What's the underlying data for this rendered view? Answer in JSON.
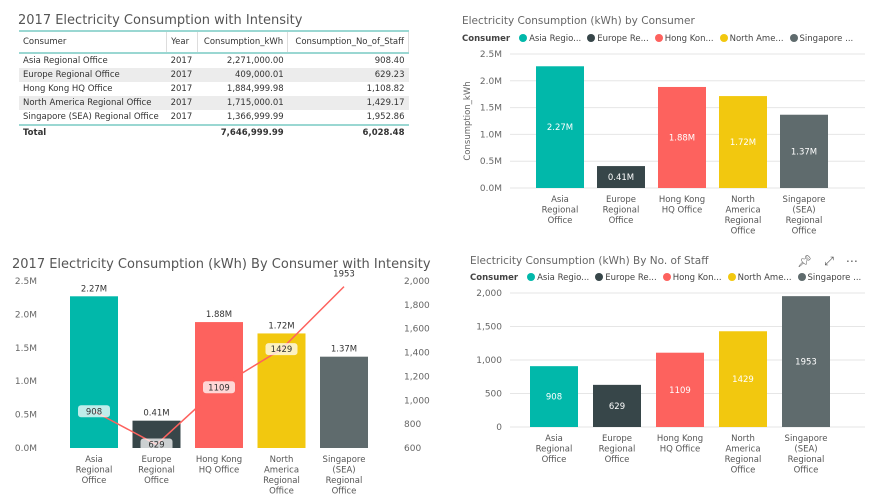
{
  "table_visual": {
    "title": "2017 Electricity Consumption with Intensity",
    "columns": [
      "Consumer",
      "Year",
      "Consumption_kWh",
      "Consumption_No_of_Staff"
    ],
    "rows": [
      [
        "Asia Regional Office",
        "2017",
        "2,271,000.00",
        "908.40"
      ],
      [
        "Europe Regional Office",
        "2017",
        "409,000.01",
        "629.23"
      ],
      [
        "Hong Kong HQ Office",
        "2017",
        "1,884,999.98",
        "1,108.82"
      ],
      [
        "North America Regional Office",
        "2017",
        "1,715,000.01",
        "1,429.17"
      ],
      [
        "Singapore (SEA) Regional Office",
        "2017",
        "1,366,999.99",
        "1,952.86"
      ]
    ],
    "total": [
      "Total",
      "",
      "7,646,999.99",
      "6,028.48"
    ]
  },
  "colors": {
    "asia": "#01B8AA",
    "europe": "#374649",
    "hongkong": "#FD625E",
    "northamerica": "#F2C80F",
    "singapore": "#5F6B6D",
    "line": "#FD625E"
  },
  "legend": {
    "title": "Consumer",
    "items": [
      "Asia Regio...",
      "Europe Re...",
      "Hong Kon...",
      "North Ame...",
      "Singapore ..."
    ]
  },
  "visual_icons": [
    "pin-icon",
    "focus-mode-icon",
    "more-options-icon"
  ],
  "chart_data": [
    {
      "type": "bar",
      "title": "Electricity Consumption (kWh) by Consumer",
      "ylabel": "Consumption_kWh",
      "categories": [
        "Asia Regional Office",
        "Europe Regional Office",
        "Hong Kong HQ Office",
        "North America Regional Office",
        "Singapore (SEA) Regional Office"
      ],
      "values": [
        2271000,
        409000,
        1885000,
        1715000,
        1367000
      ],
      "data_labels": [
        "2.27M",
        "0.41M",
        "1.88M",
        "1.72M",
        "1.37M"
      ],
      "yticks": [
        "0.0M",
        "0.5M",
        "1.0M",
        "1.5M",
        "2.0M",
        "2.5M"
      ],
      "ylim": [
        0,
        2500000
      ],
      "grid": true,
      "legend": "top-left"
    },
    {
      "type": "bar+line",
      "title": "2017 Electricity Consumption (kWh) By Consumer with Intensity",
      "categories": [
        "Asia Regional Office",
        "Europe Regional Office",
        "Hong Kong HQ Office",
        "North America Regional Office",
        "Singapore (SEA) Regional Office"
      ],
      "values": [
        2271000,
        409000,
        1885000,
        1715000,
        1367000
      ],
      "data_labels": [
        "2.27M",
        "0.41M",
        "1.88M",
        "1.72M",
        "1.37M"
      ],
      "line_values": [
        908,
        629,
        1109,
        1429,
        1953
      ],
      "line_labels": [
        "908",
        "629",
        "1109",
        "1429",
        "1953"
      ],
      "yticks": [
        "0.0M",
        "0.5M",
        "1.0M",
        "1.5M",
        "2.0M",
        "2.5M"
      ],
      "ylim": [
        0,
        2500000
      ],
      "y2ticks": [
        "600",
        "800",
        "1,000",
        "1,200",
        "1,400",
        "1,600",
        "1,800",
        "2,000"
      ],
      "y2lim": [
        600,
        2000
      ],
      "grid": false
    },
    {
      "type": "bar",
      "title": "Electricity Consumption (kWh) By No. of Staff",
      "categories": [
        "Asia Regional Office",
        "Europe Regional Office",
        "Hong Kong HQ Office",
        "North America Regional Office",
        "Singapore (SEA) Regional Office"
      ],
      "values": [
        908,
        629,
        1109,
        1429,
        1953
      ],
      "data_labels": [
        "908",
        "629",
        "1109",
        "1429",
        "1953"
      ],
      "yticks": [
        "0",
        "500",
        "1,000",
        "1,500",
        "2,000"
      ],
      "ylim": [
        0,
        2000
      ],
      "grid": true,
      "legend": "top-left"
    }
  ]
}
